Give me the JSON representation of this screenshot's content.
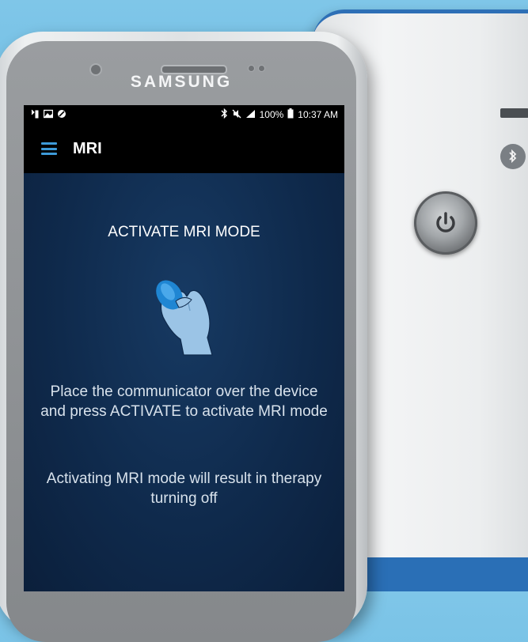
{
  "phone": {
    "brand": "SAMSUNG"
  },
  "statusbar": {
    "left_icons": [
      "notification-icon",
      "gallery-icon",
      "blocked-icon"
    ],
    "bluetooth_icon": "bluetooth-icon",
    "mute_icon": "mute-icon",
    "signal_icon": "signal-icon",
    "battery_percent": "100%",
    "battery_icon": "battery-icon",
    "time": "10:37 AM"
  },
  "appbar": {
    "menu_icon": "hamburger-menu-icon",
    "title": "MRI"
  },
  "content": {
    "heading": "ACTIVATE MRI MODE",
    "illustration": "hand-holding-communicator-icon",
    "instruction": "Place the communicator over the device and press ACTIVATE to activate MRI mode",
    "warning": "Activating MRI mode will result in therapy turning off"
  },
  "colors": {
    "accent": "#3d9ad8",
    "screen_bg": "#0f2a4c",
    "device_trim": "#2d6fb6",
    "background": "#5fb4df"
  }
}
